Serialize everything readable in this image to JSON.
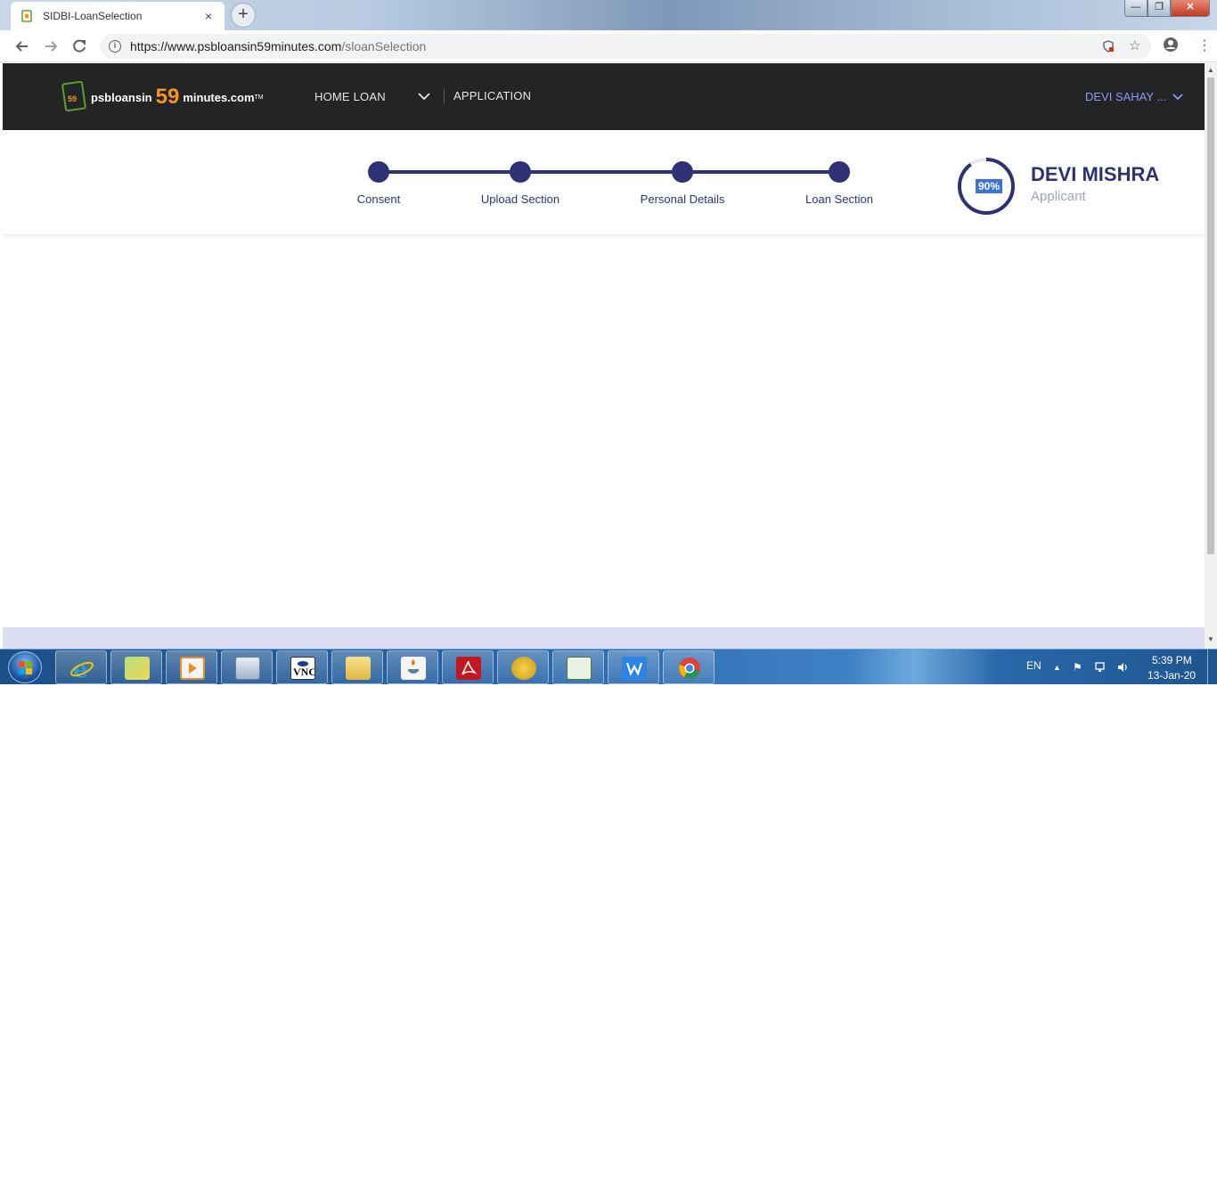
{
  "browser": {
    "tab_title": "SIDBI-LoanSelection",
    "tab_close": "×",
    "new_tab": "+",
    "url_host": "https://www.psbloansin59minutes.com",
    "url_path": "/sloanSelection",
    "window_min": "—",
    "window_max": "❐",
    "window_close": "✕"
  },
  "header": {
    "logo_text1": "psbloansin",
    "logo_59": "59",
    "logo_text2": "minutes.com",
    "logo_tm": "TM",
    "nav_home_loan": "HOME LOAN",
    "nav_application": "APPLICATION",
    "user_menu": "DEVI SAHAY ..."
  },
  "stepper": {
    "steps": [
      {
        "label": "Consent"
      },
      {
        "label": "Upload Section"
      },
      {
        "label": "Personal Details"
      },
      {
        "label": "Loan Section"
      }
    ],
    "progress_percent": 90,
    "progress_label": "90%",
    "applicant_name": "DEVI MISHRA",
    "applicant_role": "Applicant"
  },
  "taskbar": {
    "language": "EN",
    "time": "5:39 PM",
    "date": "13-Jan-20",
    "pinned": [
      "internet-explorer-icon",
      "windows-explorer-icon",
      "media-player-icon",
      "calculator-icon",
      "vnc-viewer-icon",
      "file-manager-icon",
      "java-icon",
      "acrobat-reader-icon",
      "security-shield-icon",
      "spreadsheet-icon",
      "wps-writer-icon",
      "chrome-icon"
    ]
  },
  "colors": {
    "header_bg": "#232426",
    "brand_navy": "#2e3175",
    "logo_orange": "#f7941d",
    "footer_band": "#dcdcf2"
  }
}
